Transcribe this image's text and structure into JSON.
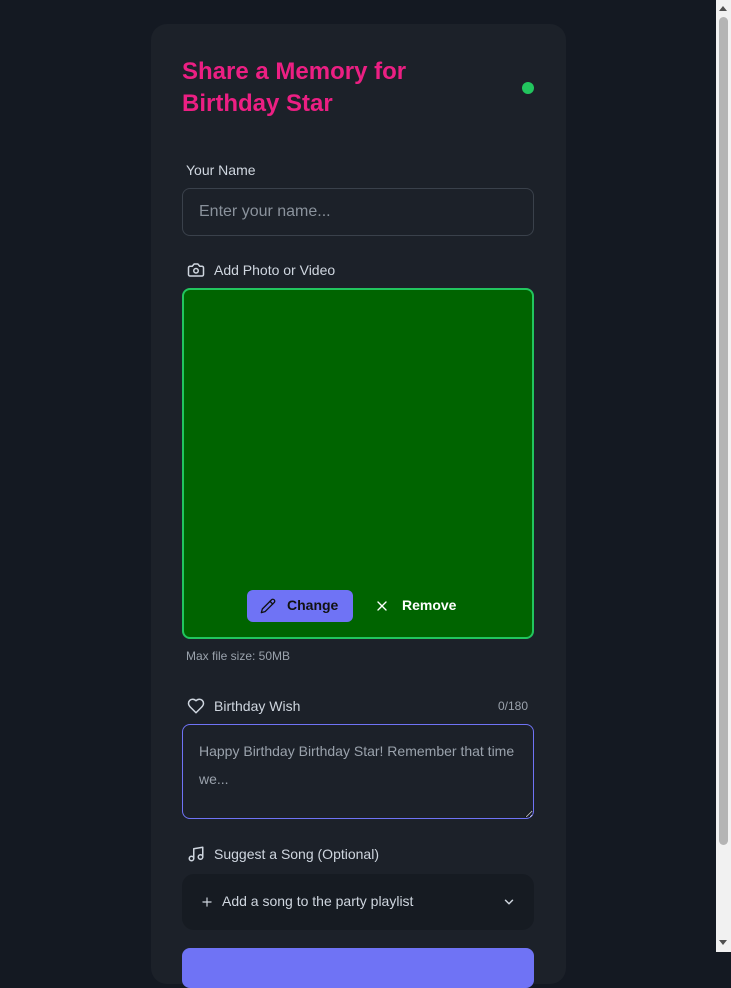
{
  "header": {
    "title": "Share a Memory for Birthday Star",
    "status_color": "#22c55e"
  },
  "name_field": {
    "label": "Your Name",
    "placeholder": "Enter your name..."
  },
  "media": {
    "label": "Add Photo or Video",
    "icon": "camera-icon",
    "change_label": "Change",
    "remove_label": "Remove",
    "max_size_note": "Max file size: 50MB"
  },
  "wish": {
    "label": "Birthday Wish",
    "icon": "heart-icon",
    "counter": "0/180",
    "placeholder": "Happy Birthday Birthday Star! Remember that time we..."
  },
  "song": {
    "label": "Suggest a Song (Optional)",
    "icon": "music-icon",
    "dropdown_label": "Add a song to the party playlist"
  },
  "colors": {
    "accent": "#6f73f5",
    "title": "#ec1f83",
    "preview_bg": "#006400"
  }
}
